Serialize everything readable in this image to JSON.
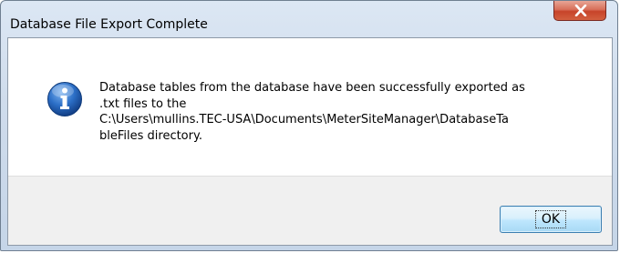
{
  "window": {
    "title": "Database File Export Complete",
    "close_label": "X"
  },
  "dialog": {
    "icon": "info-icon",
    "message": " Database tables from the database have been successfully exported as\n.txt files to the\nC:\\Users\\mullins.TEC-USA\\Documents\\MeterSiteManager\\DatabaseTa\nbleFiles directory.",
    "ok_label": "OK"
  },
  "colors": {
    "frame": "#cfdcec",
    "close_button": "#c7432a",
    "info_icon": "#1f5fb3",
    "button_area": "#f0f0f0",
    "ok_button_border": "#3c7fb1"
  }
}
